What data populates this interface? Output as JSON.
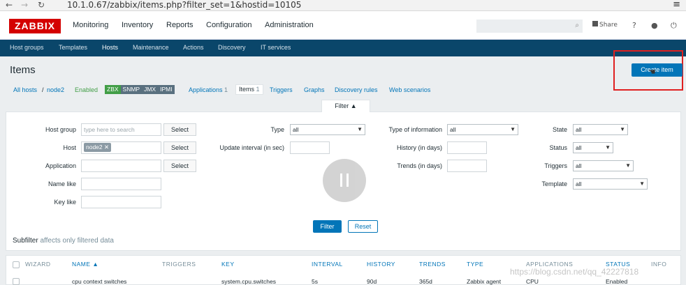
{
  "browser": {
    "url": "10.1.0.67/zabbix/items.php?filter_set=1&hostid=10105"
  },
  "topnav": {
    "logo": "ZABBIX",
    "items": [
      "Monitoring",
      "Inventory",
      "Reports",
      "Configuration",
      "Administration"
    ],
    "share": "Share",
    "help": "?"
  },
  "subnav": {
    "items": [
      "Host groups",
      "Templates",
      "Hosts",
      "Maintenance",
      "Actions",
      "Discovery",
      "IT services"
    ]
  },
  "page": {
    "title": "Items",
    "create_button": "Create item"
  },
  "breadcrumb": {
    "all_hosts": "All hosts",
    "sep": "/",
    "host": "node2",
    "status": "Enabled",
    "tags": [
      "ZBX",
      "SNMP",
      "JMX",
      "IPMI"
    ],
    "applications": "Applications",
    "applications_count": "1",
    "items": "Items",
    "items_count": "1",
    "triggers": "Triggers",
    "graphs": "Graphs",
    "discovery_rules": "Discovery rules",
    "web_scenarios": "Web scenarios"
  },
  "filter": {
    "tab_label": "Filter ▲",
    "host_group_label": "Host group",
    "host_group_placeholder": "type here to search",
    "host_label": "Host",
    "host_chip": "node2",
    "application_label": "Application",
    "name_like_label": "Name like",
    "key_like_label": "Key like",
    "select_label": "Select",
    "type_label": "Type",
    "type_value": "all",
    "update_interval_label": "Update interval (in sec)",
    "type_of_info_label": "Type of information",
    "type_of_info_value": "all",
    "history_label": "History (in days)",
    "trends_label": "Trends (in days)",
    "state_label": "State",
    "state_value": "all",
    "status_label": "Status",
    "status_value": "all",
    "triggers_label": "Triggers",
    "triggers_value": "all",
    "template_label": "Template",
    "template_value": "all",
    "apply_button": "Filter",
    "reset_button": "Reset"
  },
  "subfilter": {
    "title": "Subfilter",
    "note": "affects only filtered data"
  },
  "table": {
    "headers": [
      "WIZARD",
      "NAME ▲",
      "TRIGGERS",
      "KEY",
      "INTERVAL",
      "HISTORY",
      "TRENDS",
      "TYPE",
      "APPLICATIONS",
      "STATUS",
      "INFO"
    ],
    "row": {
      "name": "cpu context switches",
      "key": "system.cpu.switches",
      "interval": "5s",
      "history": "90d",
      "trends": "365d",
      "type": "Zabbix agent",
      "applications": "CPU",
      "status": "Enabled"
    }
  },
  "watermark": "https://blog.csdn.net/qq_42227818",
  "colors": {
    "accent": "#0275b8",
    "navbar": "#0a466a",
    "logo": "#d40000",
    "enabled": "#429e47"
  }
}
